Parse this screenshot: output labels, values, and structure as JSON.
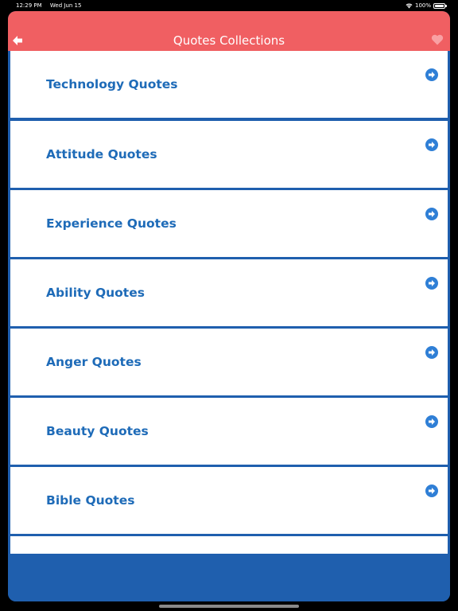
{
  "status_bar": {
    "time": "12:29 PM",
    "date": "Wed Jun 15",
    "battery": "100%"
  },
  "header": {
    "title": "Quotes Collections"
  },
  "icons": {
    "back": "back-arrow-icon",
    "favorite": "heart-icon",
    "item_arrow": "arrow-right-circle-icon"
  },
  "colors": {
    "header": "#f05f62",
    "list_background": "#1f5fae",
    "item_text": "#1e6bb8",
    "arrow": "#2f7fd6",
    "heart": "#f9a0a3"
  },
  "list": {
    "items": [
      {
        "label": "Technology Quotes"
      },
      {
        "label": "Attitude Quotes"
      },
      {
        "label": "Experience Quotes"
      },
      {
        "label": "Ability Quotes"
      },
      {
        "label": "Anger Quotes"
      },
      {
        "label": "Beauty Quotes"
      },
      {
        "label": "Bible Quotes"
      },
      {
        "label": ""
      }
    ]
  }
}
